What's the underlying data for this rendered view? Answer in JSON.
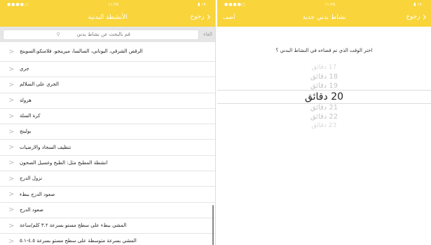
{
  "left": {
    "status": {
      "signal": "●●●●○",
      "time": "١١:٢٥",
      "battery": "▮ ٪٧٠"
    },
    "title": "الأنشطة البدنية",
    "back": "رجوع",
    "search": {
      "placeholder": "قم بالبحث عن نشاط بدني",
      "cancel": "الغاء"
    },
    "items": [
      "الرقص الشرقي، اليوناني، السالسا، ميرينجو، فلامنكو،السوينج",
      "جري",
      "الجري على السلالم",
      "هرولة",
      "كرة السلة",
      "بولينج",
      "تنظيف السجاد والارضيات",
      "انشطة المطبخ مثل: الطبخ وغسيل الصحون",
      "نزول الدرج",
      "صعود الدرج ببطء",
      "صعود الدرج",
      "المشي ببطء على سطح مستو بسرعة ٣.٢ كلم/ساعة",
      "المشي بسرعة متوسطة على سطح مستو بسرعة ٤.٥-٥.١"
    ]
  },
  "right": {
    "status": {
      "signal": "●●●●○",
      "time": "١١:٢٥",
      "battery": "▮ ٪٧٠"
    },
    "title": "نشاط بدني جديد",
    "back": "رجوع",
    "add": "أضف",
    "question": "اختر الوقت الذي تم قضاءه في النشاط البدني ؟",
    "picker": [
      "17 دقائق",
      "18 دقائق",
      "19 دقائق",
      "20 دقائق",
      "21 دقائق",
      "22 دقائق",
      "23 دقائق"
    ],
    "selected": "20 دقائق"
  },
  "colors": {
    "accent": "#f9d43a"
  }
}
